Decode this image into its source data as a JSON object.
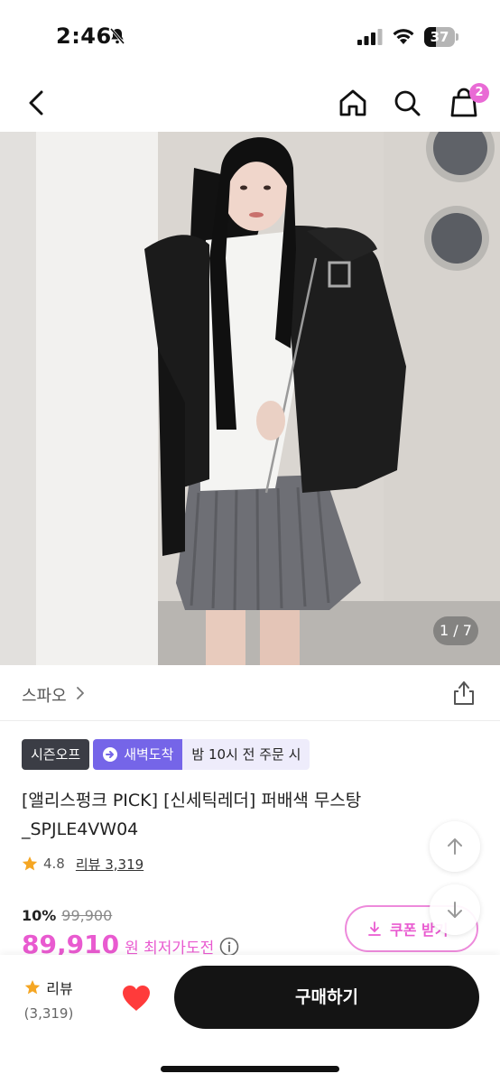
{
  "status_bar": {
    "time": "2:46",
    "battery_level": "37"
  },
  "nav": {
    "cart_count": "2"
  },
  "hero": {
    "page_indicator": "1 / 7"
  },
  "brand": {
    "name": "스파오"
  },
  "badges": {
    "season": "시즌오프",
    "dawn_delivery": "새벽도착",
    "order_deadline": "밤 10시 전 주문 시"
  },
  "product": {
    "title": "[앨리스펑크 PICK] [신세틱레더] 퍼배색 무스탕 _SPJLE4VW04",
    "rating": "4.8",
    "review_label": "리뷰 3,319"
  },
  "price": {
    "discount_rate": "10%",
    "original_price": "99,900",
    "sale_price": "89,910",
    "suffix": "원 최저가도전"
  },
  "coupon": {
    "label": "쿠폰 받기"
  },
  "bottom_bar": {
    "review_label": "리뷰",
    "review_count": "(3,319)",
    "buy_label": "구매하기"
  },
  "colors": {
    "accent_pink": "#e95ad0",
    "dawn_purple": "#7565e8",
    "buy_button": "#141414",
    "star": "#f5a623",
    "heart": "#ff3b3b"
  }
}
